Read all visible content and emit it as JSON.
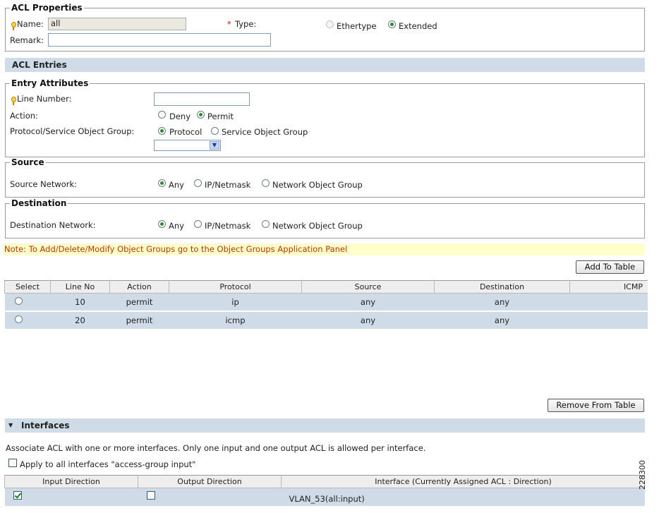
{
  "acl_properties": {
    "legend": "ACL Properties",
    "name_label": "Name:",
    "name_value": "all",
    "type_label": "Type:",
    "type_required_mark": "*",
    "type_options": [
      "Ethertype",
      "Extended"
    ],
    "type_selected": "Extended",
    "remark_label": "Remark:",
    "remark_value": ""
  },
  "acl_entries_header": "ACL Entries",
  "entry_attributes": {
    "legend": "Entry Attributes",
    "line_number_label": "Line Number:",
    "line_number_value": "",
    "action_label": "Action:",
    "action_options": [
      "Deny",
      "Permit"
    ],
    "action_selected": "Permit",
    "protocol_group_label": "Protocol/Service Object Group:",
    "protocol_options": [
      "Protocol",
      "Service Object Group"
    ],
    "protocol_selected": "Protocol",
    "protocol_dropdown_value": ""
  },
  "source": {
    "legend": "Source",
    "network_label": "Source Network:",
    "options": [
      "Any",
      "IP/Netmask",
      "Network Object Group"
    ],
    "selected": "Any"
  },
  "destination": {
    "legend": "Destination",
    "network_label": "Destination Network:",
    "options": [
      "Any",
      "IP/Netmask",
      "Network Object Group"
    ],
    "selected": "Any"
  },
  "note": "Note: To Add/Delete/Modify Object Groups go to the Object Groups Application Panel",
  "add_to_table_label": "Add To Table",
  "entries_table": {
    "columns": [
      "Select",
      "Line No",
      "Action",
      "Protocol",
      "Source",
      "Destination",
      "ICMP"
    ],
    "rows": [
      {
        "line_no": "10",
        "action": "permit",
        "protocol": "ip",
        "source": "any",
        "destination": "any"
      },
      {
        "line_no": "20",
        "action": "permit",
        "protocol": "icmp",
        "source": "any",
        "destination": "any"
      }
    ]
  },
  "remove_from_table_label": "Remove From Table",
  "interfaces": {
    "header": "Interfaces",
    "description": "Associate ACL with one or more interfaces. Only one input and one output ACL is allowed per interface.",
    "apply_all_label": "Apply to all interfaces \"access-group input\"",
    "apply_all_checked": false,
    "columns": [
      "Input Direction",
      "Output Direction",
      "Interface (Currently Assigned ACL : Direction)"
    ],
    "rows": [
      {
        "input_checked": true,
        "output_checked": false,
        "interface": "VLAN_53(all:input)"
      }
    ]
  },
  "figure_id": "228300",
  "colors": {
    "section_bar": "#cfdce8",
    "note_background": "#ffffcc",
    "note_text": "#b03a00",
    "radio_selected": "#2e8a2e",
    "required_mark": "#d11"
  }
}
